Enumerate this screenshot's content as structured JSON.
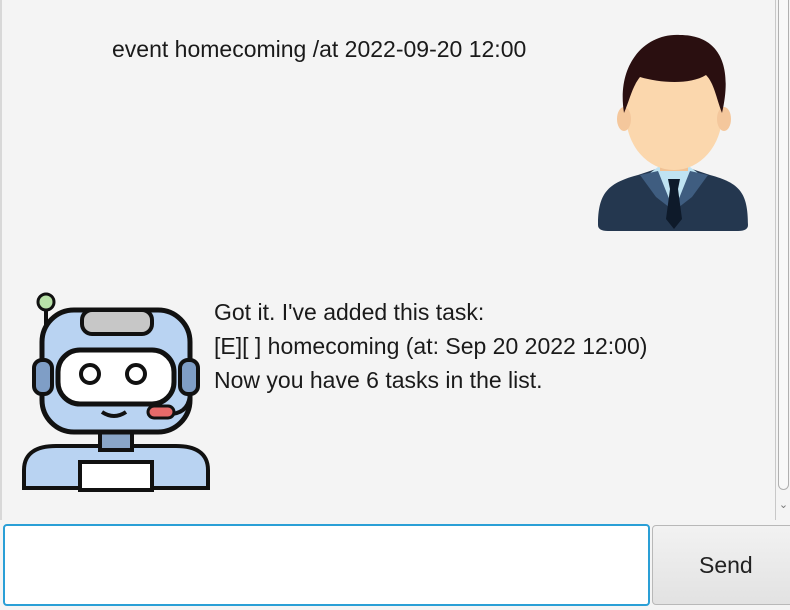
{
  "dialog": {
    "user_message": "event homecoming /at 2022-09-20 12:00",
    "bot_message": "Got it. I've added this task:\n[E][ ] homecoming (at: Sep 20 2022 12:00)\nNow you have 6 tasks in the list."
  },
  "avatars": {
    "user": "user-avatar-icon",
    "bot": "robot-avatar-icon"
  },
  "input": {
    "value": "",
    "placeholder": ""
  },
  "send_button": {
    "label": "Send"
  },
  "colors": {
    "background": "#f4f4f4",
    "input_focus_border": "#2a9fd6",
    "robot_body": "#b9d3f2",
    "user_suit": "#24374f"
  }
}
